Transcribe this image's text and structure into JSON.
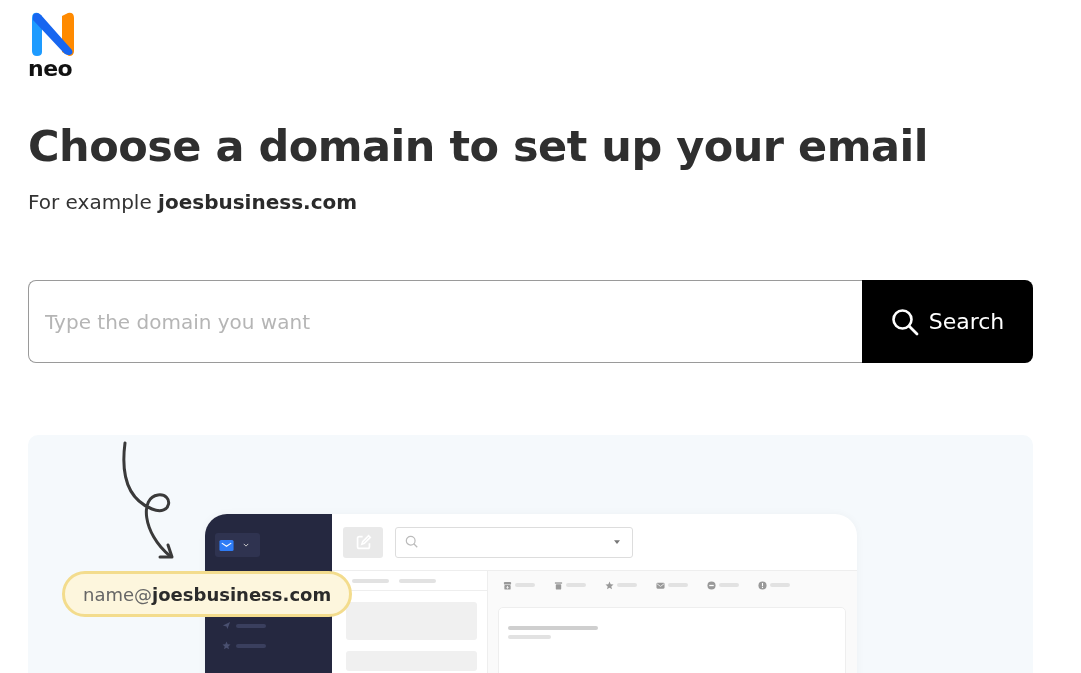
{
  "logo": {
    "text": "neo"
  },
  "heading": "Choose a domain to set up your email",
  "subtitle": "For example **joesbusiness.com**",
  "search": {
    "placeholder": "Type the domain you want",
    "button": "Search"
  },
  "illustration": {
    "email": "name@**joesbusiness.com**"
  }
}
